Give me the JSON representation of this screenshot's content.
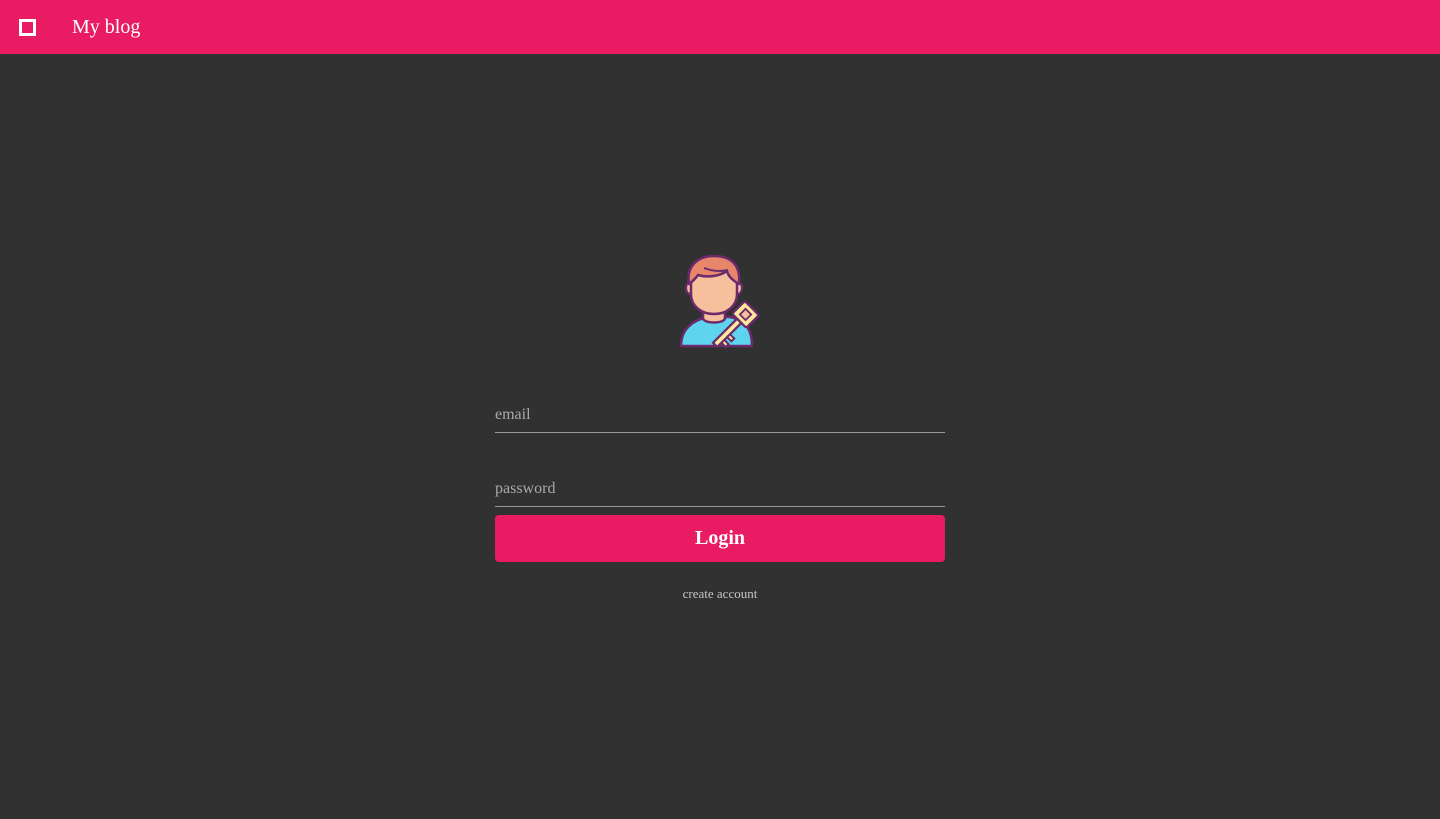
{
  "header": {
    "menu_icon": "square-menu-icon",
    "title": "My blog",
    "background_color": "#e91b63"
  },
  "login": {
    "avatar_icon": "user-with-key-icon",
    "email": {
      "placeholder": "email",
      "value": ""
    },
    "password": {
      "placeholder": "password",
      "value": ""
    },
    "submit_label": "Login",
    "create_account_label": "create account"
  },
  "colors": {
    "page_background": "#313131",
    "accent": "#e91b63"
  }
}
